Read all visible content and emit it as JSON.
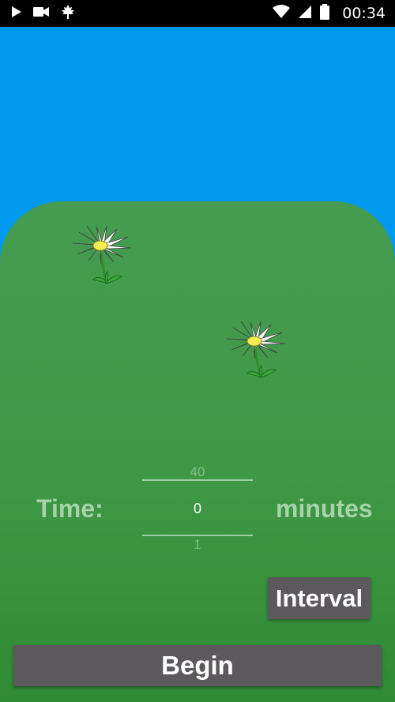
{
  "status_bar": {
    "time": "00:34",
    "left_icons": [
      "play-icon",
      "video-camera-icon",
      "maple-leaf-icon"
    ],
    "right_icons": [
      "wifi-icon",
      "cell-signal-icon",
      "battery-icon"
    ]
  },
  "timer": {
    "label": "Time:",
    "unit": "minutes",
    "picker": {
      "previous": "40",
      "current": "0",
      "next": "1"
    }
  },
  "buttons": {
    "interval": "Interval",
    "begin": "Begin"
  },
  "colors": {
    "sky": "#0099f0",
    "meadow": "#459c4f",
    "button": "#5b595c",
    "label": "#a6d3a9"
  },
  "decorations": [
    "daisy-flower",
    "daisy-flower"
  ]
}
